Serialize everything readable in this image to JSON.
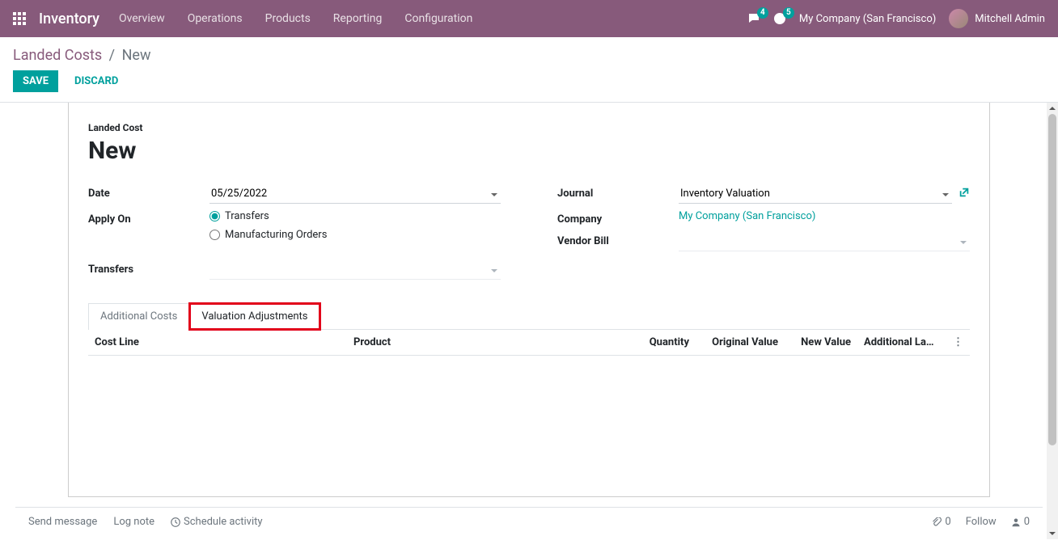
{
  "topbar": {
    "brand": "Inventory",
    "menu": [
      "Overview",
      "Operations",
      "Products",
      "Reporting",
      "Configuration"
    ],
    "messages_badge": "4",
    "activities_badge": "5",
    "company": "My Company (San Francisco)",
    "user": "Mitchell Admin"
  },
  "breadcrumb": {
    "parent": "Landed Costs",
    "current": "New"
  },
  "buttons": {
    "save": "Save",
    "discard": "Discard"
  },
  "form": {
    "small_title": "Landed Cost",
    "title": "New",
    "labels": {
      "date": "Date",
      "apply_on": "Apply On",
      "transfers": "Transfers",
      "journal": "Journal",
      "company": "Company",
      "vendor_bill": "Vendor Bill"
    },
    "values": {
      "date": "05/25/2022",
      "apply_on_transfers": "Transfers",
      "apply_on_mo": "Manufacturing Orders",
      "journal": "Inventory Valuation",
      "company": "My Company (San Francisco)"
    }
  },
  "tabs": {
    "additional_costs": "Additional Costs",
    "valuation_adjustments": "Valuation Adjustments"
  },
  "table": {
    "cols": {
      "cost_line": "Cost Line",
      "product": "Product",
      "quantity": "Quantity",
      "original_value": "Original Value",
      "new_value": "New Value",
      "additional_landed": "Additional La…"
    }
  },
  "chatter": {
    "send_message": "Send message",
    "log_note": "Log note",
    "schedule_activity": "Schedule activity",
    "attachments": "0",
    "follow": "Follow",
    "followers": "0"
  }
}
